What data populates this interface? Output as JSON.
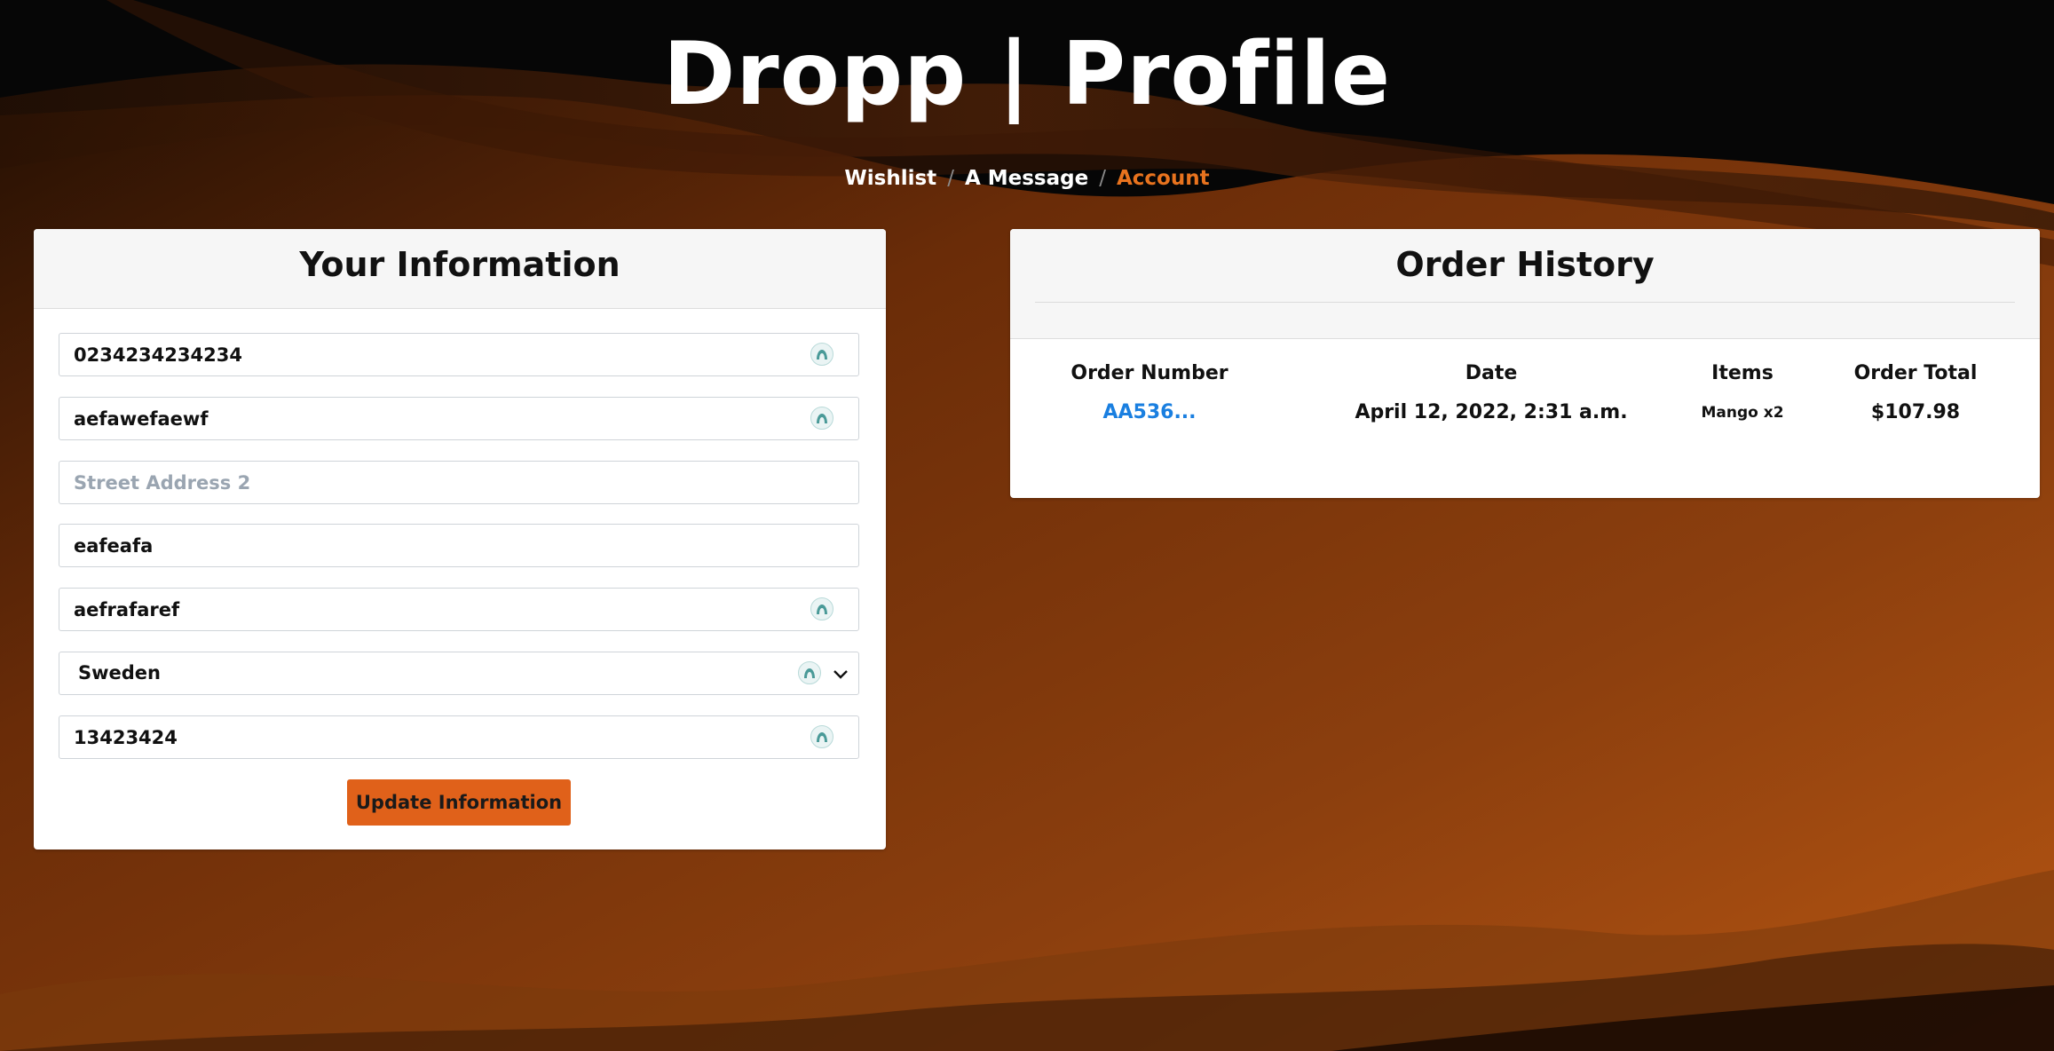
{
  "page": {
    "title": "Dropp | Profile"
  },
  "breadcrumb": {
    "items": [
      {
        "label": "Wishlist"
      },
      {
        "label": "A Message"
      },
      {
        "label": "Account"
      }
    ],
    "separator": "/"
  },
  "info_card": {
    "title": "Your Information",
    "fields": [
      {
        "value": "0234234234234",
        "placeholder": "",
        "has_password_icon": true
      },
      {
        "value": "aefawefaewf",
        "placeholder": "",
        "has_password_icon": true
      },
      {
        "value": "",
        "placeholder": "Street Address 2",
        "has_password_icon": false
      },
      {
        "value": "eafeafa",
        "placeholder": "",
        "has_password_icon": false
      },
      {
        "value": "aefrafaref",
        "placeholder": "",
        "has_password_icon": true
      },
      {
        "value": "Sweden",
        "type": "select",
        "has_password_icon": true
      },
      {
        "value": "13423424",
        "placeholder": "",
        "has_password_icon": true
      }
    ],
    "submit_label": "Update Information"
  },
  "orders_card": {
    "title": "Order History",
    "columns": [
      "Order Number",
      "Date",
      "Items",
      "Order Total"
    ],
    "rows": [
      {
        "order_number": "AA536...",
        "date": "April 12, 2022, 2:31 a.m.",
        "items": "Mango x2",
        "total": "$107.98"
      }
    ]
  },
  "colors": {
    "accent": "#e0611a",
    "active_crumb": "#e8731e",
    "link": "#1a7fe0",
    "icon": "#4a9a98"
  },
  "icons": {
    "field_badge": "password-manager-icon",
    "select_caret": "chevron-down-icon"
  }
}
